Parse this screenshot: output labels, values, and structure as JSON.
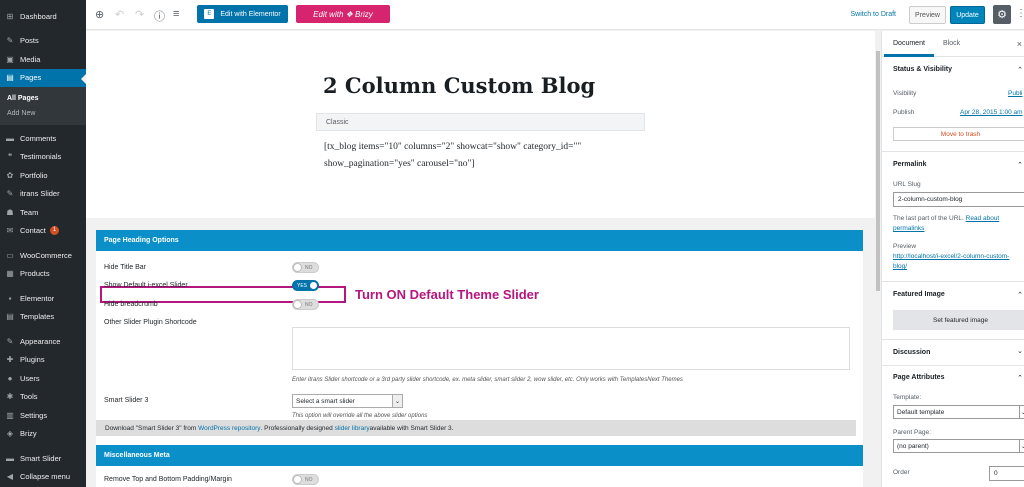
{
  "sidebar": {
    "items": [
      {
        "label": "Dashboard",
        "icon": "dashboard-icon",
        "glyph": "⊞"
      },
      {
        "label": "Posts",
        "icon": "pushpin-icon",
        "glyph": "✎"
      },
      {
        "label": "Media",
        "icon": "media-icon",
        "glyph": "▣"
      },
      {
        "label": "Pages",
        "icon": "pages-icon",
        "glyph": "▤"
      },
      {
        "label": "Comments",
        "icon": "comments-icon",
        "glyph": "▬"
      },
      {
        "label": "Testimonials",
        "icon": "quote-icon",
        "glyph": "❝"
      },
      {
        "label": "Portfolio",
        "icon": "portfolio-icon",
        "glyph": "✿"
      },
      {
        "label": "itrans Slider",
        "icon": "slider-icon",
        "glyph": "✎"
      },
      {
        "label": "Team",
        "icon": "team-icon",
        "glyph": "☗"
      },
      {
        "label": "Contact",
        "icon": "mail-icon",
        "glyph": "✉",
        "badge": "1"
      },
      {
        "label": "WooCommerce",
        "icon": "woocommerce-icon",
        "glyph": "▭"
      },
      {
        "label": "Products",
        "icon": "products-icon",
        "glyph": "▦"
      },
      {
        "label": "Elementor",
        "icon": "elementor-icon",
        "glyph": "▪"
      },
      {
        "label": "Templates",
        "icon": "templates-icon",
        "glyph": "▤"
      },
      {
        "label": "Appearance",
        "icon": "appearance-icon",
        "glyph": "✎"
      },
      {
        "label": "Plugins",
        "icon": "plugins-icon",
        "glyph": "✚"
      },
      {
        "label": "Users",
        "icon": "users-icon",
        "glyph": "●"
      },
      {
        "label": "Tools",
        "icon": "tools-icon",
        "glyph": "✱"
      },
      {
        "label": "Settings",
        "icon": "settings-icon",
        "glyph": "▥"
      },
      {
        "label": "Brizy",
        "icon": "brizy-icon",
        "glyph": "◈"
      },
      {
        "label": "Smart Slider",
        "icon": "smart-slider-icon",
        "glyph": "▬"
      },
      {
        "label": "Collapse menu",
        "icon": "collapse-icon",
        "glyph": "◀"
      }
    ],
    "submenu": [
      "All Pages",
      "Add New"
    ]
  },
  "toolbar": {
    "elementor_label": "Edit with Elementor",
    "elementor_glyph": "E",
    "brizy_label": "Edit with ❖ Brizy",
    "switch_draft": "Switch to Draft",
    "preview": "Preview",
    "update": "Update",
    "add_glyph": "⊕",
    "undo_glyph": "↶",
    "redo_glyph": "↷",
    "info_glyph": "ⓘ",
    "outline_glyph": "≡",
    "gear_glyph": "⚙",
    "more_glyph": "⋮"
  },
  "editor": {
    "title": "2 Column Custom Blog",
    "classic_label": "Classic",
    "shortcode": "[tx_blog items=\"10\" columns=\"2\" showcat=\"show\" category_id=\"\" show_pagination=\"yes\" carousel=\"no\"]"
  },
  "page_heading": {
    "title": "Page Heading Options",
    "hide_title_bar": "Hide Title Bar",
    "show_default_slider": "Show Default i-excel Slider",
    "hide_breadcrumb": "Hide breadcrumb",
    "other_shortcode": "Other Slider Plugin Shortcode",
    "shortcode_help": "Enter itrans Slider shortcode or a 3rd party slider shortcode, ex. meta slider, smart slider 2, wow slider, etc. Only works with TemplatesNext Themes",
    "smart_slider_label": "Smart Slider 3",
    "smart_slider_value": "Select a smart slider",
    "smart_slider_help": "This option will override all the above slider options",
    "toggle_no": "NO",
    "toggle_yes": "YES",
    "annotation": "Turn ON Default Theme Slider",
    "notice_pre": "Download \"Smart Slider 3\" from ",
    "notice_link1": "WordPress repository",
    "notice_mid": ". Professionally designed ",
    "notice_link2": "slider library",
    "notice_post": " available with Smart Slider 3."
  },
  "misc": {
    "title": "Miscellaneous Meta",
    "remove_padding": "Remove Top and Bottom Padding/Margin"
  },
  "settings": {
    "tab_document": "Document",
    "tab_block": "Block",
    "close_glyph": "×",
    "chev_up": "⌃",
    "chev_down": "⌄",
    "status_title": "Status & Visibility",
    "visibility_label": "Visibility",
    "visibility_value": "Publi",
    "publish_label": "Publish",
    "publish_value": "Apr 28, 2015 1:00 am",
    "trash": "Move to trash",
    "permalink_title": "Permalink",
    "url_slug_label": "URL Slug",
    "url_slug_value": "2-column-custom-blog",
    "slug_help_pre": "The last part of the URL. ",
    "slug_help_link": "Read about",
    "slug_help_link2": "permalinks",
    "preview_label": "Preview",
    "preview_link1": "http://localhost/i-excel/2-column-custom-",
    "preview_link2": "blog/",
    "featured_title": "Featured Image",
    "featured_btn": "Set featured image",
    "discussion_title": "Discussion",
    "attributes_title": "Page Attributes",
    "template_label": "Template:",
    "template_value": "Default template",
    "parent_label": "Parent Page:",
    "parent_value": "(no parent)",
    "order_label": "Order",
    "order_value": "0"
  }
}
